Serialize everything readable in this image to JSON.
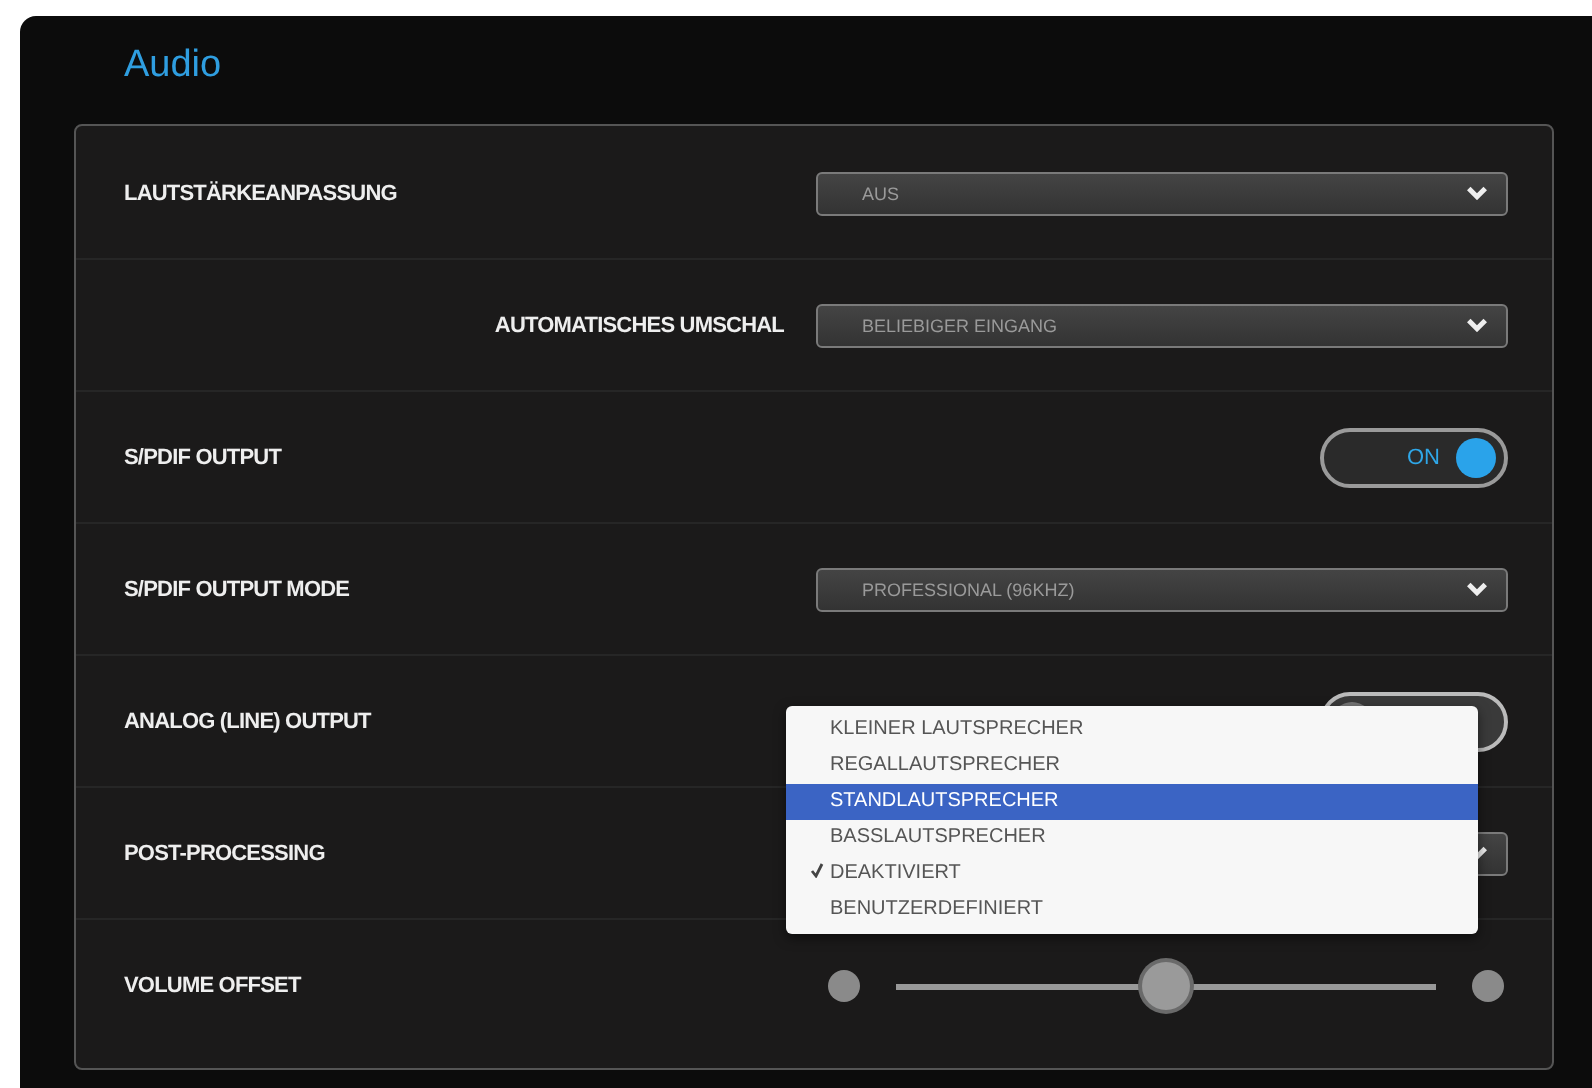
{
  "title": "Audio",
  "settings": [
    {
      "label": "LAUTSTÄRKEANPASSUNG",
      "right_aligned": false,
      "kind": "select",
      "value": "AUS"
    },
    {
      "label": "AUTOMATISCHES UMSCHAL",
      "right_aligned": true,
      "kind": "select",
      "value": "BELIEBIGER EINGANG"
    },
    {
      "label": "S/PDIF OUTPUT",
      "right_aligned": false,
      "kind": "toggle",
      "on": true,
      "state_text": "ON"
    },
    {
      "label": "S/PDIF OUTPUT MODE",
      "right_aligned": false,
      "kind": "select",
      "value": "PROFESSIONAL (96KHZ)"
    },
    {
      "label": "ANALOG (LINE) OUTPUT",
      "right_aligned": false,
      "kind": "toggle",
      "on": false
    },
    {
      "label": "POST-PROCESSING",
      "right_aligned": false,
      "kind": "select"
    },
    {
      "label": "VOLUME OFFSET",
      "right_aligned": false,
      "kind": "slider",
      "level": 0.5
    }
  ],
  "menu": {
    "items": [
      {
        "label": "KLEINER LAUTSPRECHER",
        "selected": false,
        "checked": false
      },
      {
        "label": "REGALLAUTSPRECHER",
        "selected": false,
        "checked": false
      },
      {
        "label": "STANDLAUTSPRECHER",
        "selected": true,
        "checked": false
      },
      {
        "label": "BASSLAUTSPRECHER",
        "selected": false,
        "checked": false
      },
      {
        "label": "DEAKTIVIERT",
        "selected": false,
        "checked": true
      },
      {
        "label": "BENUTZERDEFINIERT",
        "selected": false,
        "checked": false
      }
    ]
  }
}
